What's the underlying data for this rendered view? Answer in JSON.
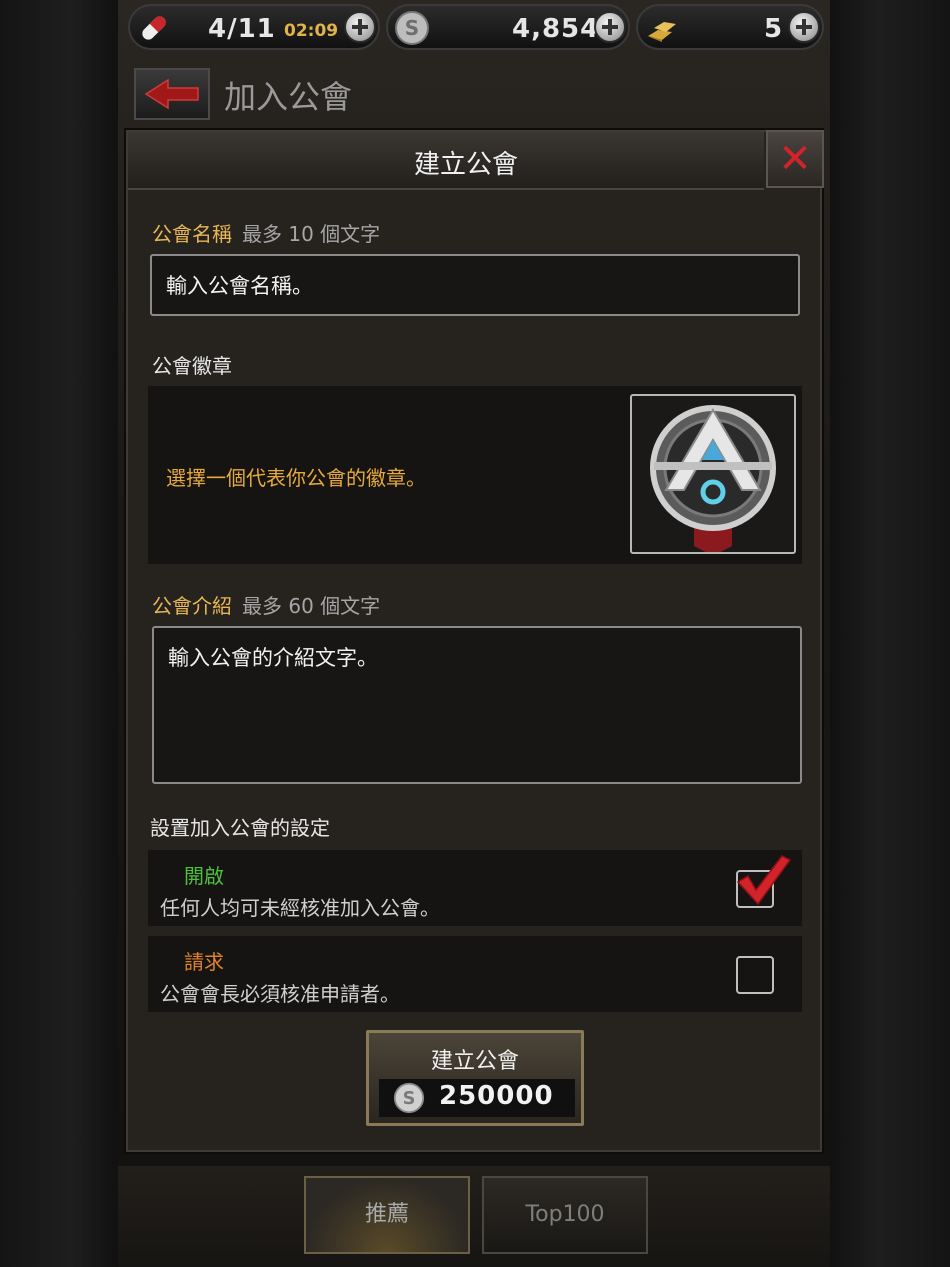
{
  "resources": {
    "stamina": {
      "value": "4/11",
      "timer": "02:09",
      "icon": "pill-icon"
    },
    "silver": {
      "value": "4,854",
      "icon": "silver-coin-icon"
    },
    "gold": {
      "value": "5",
      "icon": "gold-bars-icon"
    }
  },
  "header": {
    "title": "加入公會",
    "back_icon": "back-arrow-icon"
  },
  "dialog": {
    "title": "建立公會",
    "close_icon": "close-icon",
    "name": {
      "label": "公會名稱",
      "limit": "最多 10 個文字",
      "placeholder": "輸入公會名稱。"
    },
    "emblem": {
      "label": "公會徽章",
      "hint": "選擇一個代表你公會的徽章。"
    },
    "intro": {
      "label": "公會介紹",
      "limit": "最多 60 個文字",
      "placeholder": "輸入公會的介紹文字。"
    },
    "join_settings": {
      "label": "設置加入公會的設定",
      "options": [
        {
          "title": "開啟",
          "desc": "任何人均可未經核准加入公會。",
          "checked": true,
          "color": "#4cc13a"
        },
        {
          "title": "請求",
          "desc": "公會會長必須核准申請者。",
          "checked": false,
          "color": "#e0822a"
        }
      ]
    },
    "create_button": {
      "label": "建立公會",
      "cost": "250000"
    }
  },
  "bottom_tabs": [
    {
      "label": "推薦",
      "active": true
    },
    {
      "label": "Top100",
      "active": false
    }
  ],
  "colors": {
    "accent_gold": "#e7b655",
    "close_red": "#d2232a",
    "check_red": "#d2232a"
  }
}
